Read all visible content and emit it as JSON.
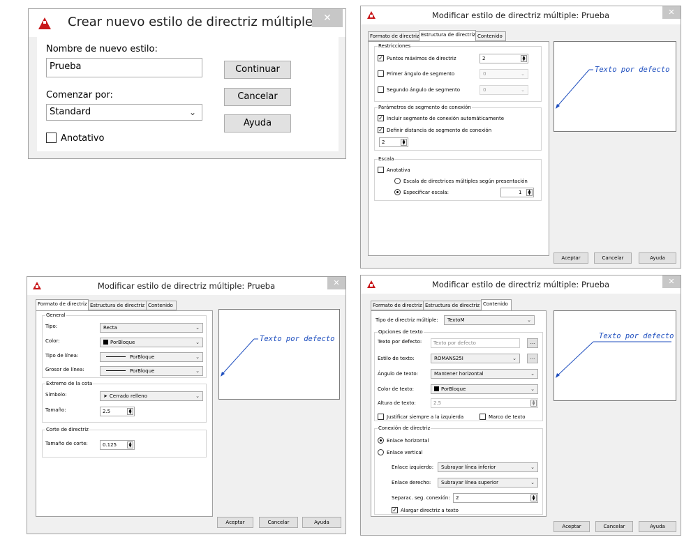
{
  "dlg_new": {
    "title": "Crear nuevo estilo de directriz múltiple",
    "close": "✕",
    "name_label": "Nombre de nuevo estilo:",
    "name_value": "Prueba",
    "start_label": "Comenzar por:",
    "start_value": "Standard",
    "annotative": "Anotativo",
    "btn_continue": "Continuar",
    "btn_cancel": "Cancelar",
    "btn_help": "Ayuda"
  },
  "modify_title": "Modificar estilo de directriz múltiple: Prueba",
  "tabs": [
    "Formato de directriz",
    "Estructura de directriz",
    "Contenido"
  ],
  "buttons": {
    "ok": "Aceptar",
    "cancel": "Cancelar",
    "help": "Ayuda"
  },
  "preview_text": "Texto por defecto",
  "close": "✕",
  "structure": {
    "restricciones": "Restricciones",
    "max_points_label": "Puntos máximos de directriz",
    "max_points_value": "2",
    "first_angle_label": "Primer ángulo de segmento",
    "first_angle_value": "0",
    "second_angle_label": "Segundo ángulo de segmento",
    "second_angle_value": "0",
    "landing_group": "Parámetros de segmento de conexión",
    "auto_landing": "Incluir segmento de conexión automáticamente",
    "landing_distance": "Definir distancia de segmento de conexión",
    "landing_distance_value": "2",
    "scale_group": "Escala",
    "annotative": "Anotativa",
    "scale_layout": "Escala de directrices múltiples según presentación",
    "scale_specify": "Especificar escala:",
    "scale_value": "1"
  },
  "format": {
    "general": "General",
    "type_label": "Tipo:",
    "type_value": "Recta",
    "color_label": "Color:",
    "color_value": "PorBloque",
    "linetype_label": "Tipo de línea:",
    "linetype_value": "PorBloque",
    "lineweight_label": "Grosor de línea:",
    "lineweight_value": "PorBloque",
    "arrow_group": "Extremo de la cota",
    "symbol_label": "Símbolo:",
    "symbol_value": "Cerrado relleno",
    "size_label": "Tamaño:",
    "size_value": "2.5",
    "break_group": "Corte de directriz",
    "break_label": "Tamaño de corte:",
    "break_value": "0.125"
  },
  "content": {
    "type_label": "Tipo de directriz múltiple:",
    "type_value": "TextoM",
    "text_opts": "Opciones de texto",
    "default_text_label": "Texto por defecto:",
    "default_text_value": "Texto por defecto",
    "text_style_label": "Estilo de texto:",
    "text_style_value": "ROMANS25I",
    "text_angle_label": "Ángulo de texto:",
    "text_angle_value": "Mantener horizontal",
    "text_color_label": "Color de texto:",
    "text_color_value": "PorBloque",
    "text_height_label": "Altura de texto:",
    "text_height_value": "2.5",
    "justify_left": "Justificar siempre a la izquierda",
    "frame_text": "Marco de texto",
    "conn_group": "Conexión de directriz",
    "horizontal": "Enlace horizontal",
    "vertical": "Enlace vertical",
    "left_label": "Enlace izquierdo:",
    "left_value": "Subrayar línea inferior",
    "right_label": "Enlace derecho:",
    "right_value": "Subrayar línea superior",
    "gap_label": "Separac. seg. conexión:",
    "gap_value": "2",
    "extend": "Alargar directriz a texto",
    "ellipsis": "..."
  },
  "colors": {
    "accent": "#1f4fbf",
    "logo": "#c8171a",
    "close": "#c7c7c7"
  }
}
